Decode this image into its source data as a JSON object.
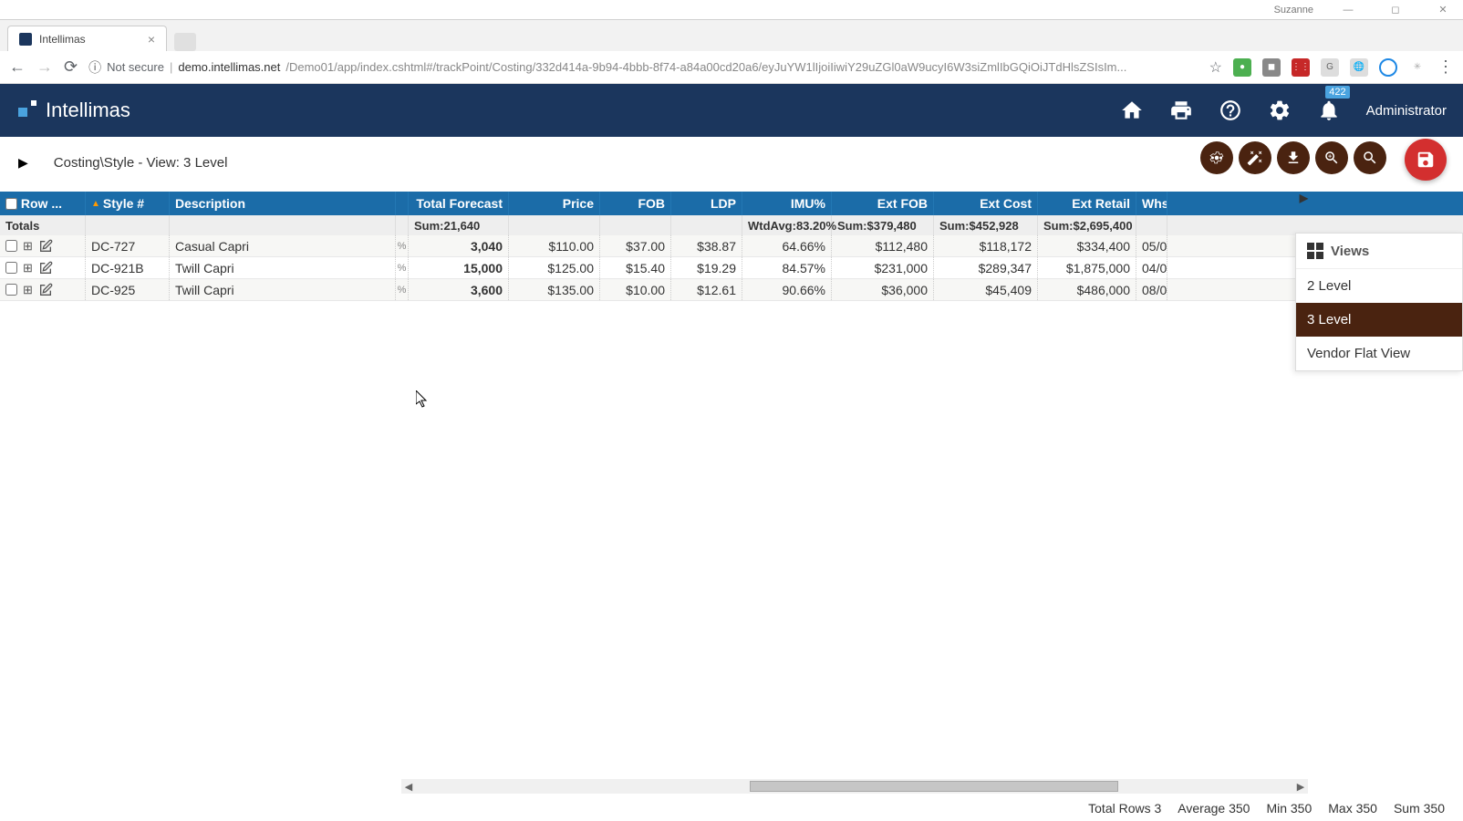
{
  "window": {
    "user": "Suzanne"
  },
  "browser": {
    "tab_title": "Intellimas",
    "not_secure": "Not secure",
    "url_host": "demo.intellimas.net",
    "url_path": "/Demo01/app/index.cshtml#/trackPoint/Costing/332d414a-9b94-4bbb-8f74-a84a00cd20a6/eyJuYW1lIjoiIiwiY29uZGl0aW9ucyI6W3siZmlIbGQiOiJTdHlsZSIsIm..."
  },
  "header": {
    "brand": "Intellimas",
    "notif_badge": "422",
    "user_label": "Administrator"
  },
  "toolbar": {
    "breadcrumb": "Costing\\Style - View: 3 Level"
  },
  "grid": {
    "headers": {
      "row": "Row ...",
      "style": "Style #",
      "desc": "Description",
      "forecast": "Total Forecast",
      "price": "Price",
      "fob": "FOB",
      "ldp": "LDP",
      "imu": "IMU%",
      "extfob": "Ext FOB",
      "extcost": "Ext Cost",
      "extret": "Ext Retail",
      "whse": "Whs"
    },
    "totals": {
      "label": "Totals",
      "forecast": "Sum:21,640",
      "imu": "WtdAvg:83.20%",
      "extfob": "Sum:$379,480",
      "extcost": "Sum:$452,928",
      "extret": "Sum:$2,695,400"
    },
    "rows": [
      {
        "style": "DC-727",
        "desc": "Casual Capri",
        "forecast": "3,040",
        "price": "$110.00",
        "fob": "$37.00",
        "ldp": "$38.87",
        "imu": "64.66%",
        "extfob": "$112,480",
        "extcost": "$118,172",
        "extret": "$334,400",
        "whse": "05/0"
      },
      {
        "style": "DC-921B",
        "desc": "Twill Capri",
        "forecast": "15,000",
        "price": "$125.00",
        "fob": "$15.40",
        "ldp": "$19.29",
        "imu": "84.57%",
        "extfob": "$231,000",
        "extcost": "$289,347",
        "extret": "$1,875,000",
        "whse": "04/0"
      },
      {
        "style": "DC-925",
        "desc": "Twill Capri",
        "forecast": "3,600",
        "price": "$135.00",
        "fob": "$10.00",
        "ldp": "$12.61",
        "imu": "90.66%",
        "extfob": "$36,000",
        "extcost": "$45,409",
        "extret": "$486,000",
        "whse": "08/0"
      }
    ]
  },
  "views": {
    "title": "Views",
    "items": [
      "2 Level",
      "3 Level",
      "Vendor Flat View"
    ],
    "active": "3 Level"
  },
  "status": {
    "total_rows": "Total Rows 3",
    "avg": "Average 350",
    "min": "Min 350",
    "max": "Max 350",
    "sum": "Sum 350"
  }
}
